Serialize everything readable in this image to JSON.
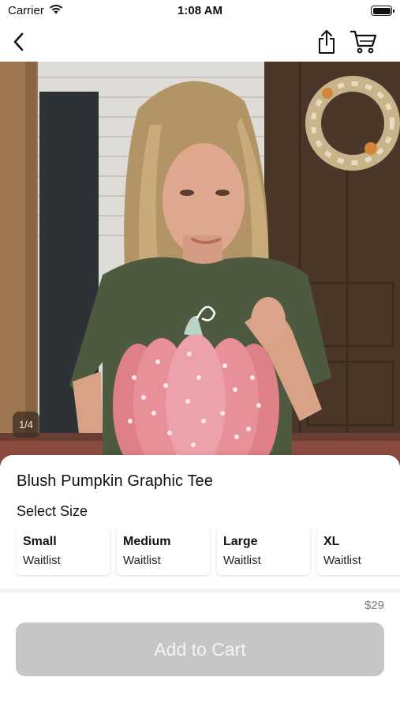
{
  "status_bar": {
    "carrier": "Carrier",
    "time": "1:08 AM",
    "icons": [
      "wifi-icon",
      "battery-icon"
    ]
  },
  "nav": {
    "icons": [
      "chevron-left-icon",
      "share-icon",
      "cart-icon"
    ]
  },
  "gallery": {
    "page_indicator": "1/4",
    "current_index": 1,
    "total": 4
  },
  "product": {
    "title": "Blush Pumpkin Graphic Tee",
    "select_size_label": "Select Size",
    "sizes": [
      {
        "name": "Small",
        "status": "Waitlist"
      },
      {
        "name": "Medium",
        "status": "Waitlist"
      },
      {
        "name": "Large",
        "status": "Waitlist"
      },
      {
        "name": "XL",
        "status": "Waitlist"
      }
    ],
    "price": "$29",
    "add_to_cart_label": "Add to Cart"
  },
  "colors": {
    "add_to_cart_disabled_bg": "#c6c6c6",
    "add_to_cart_text": "#f4f4f4",
    "shirt": "#4d5a3f",
    "pumpkin": "#e8888f"
  }
}
